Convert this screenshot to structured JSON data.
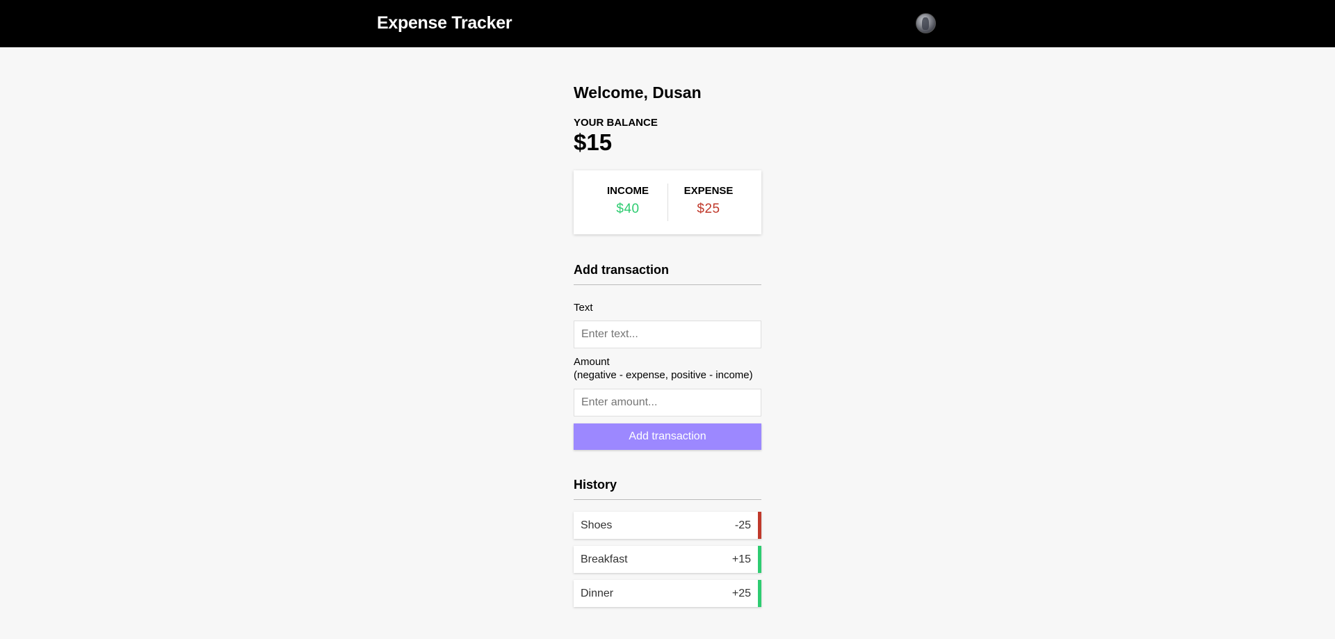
{
  "header": {
    "title": "Expense Tracker",
    "avatar_icon": "user-avatar-photo"
  },
  "welcome": "Welcome, Dusan",
  "balance": {
    "label": "YOUR BALANCE",
    "value": "$15"
  },
  "summary": {
    "income_label": "INCOME",
    "income_value": "$40",
    "expense_label": "EXPENSE",
    "expense_value": "$25"
  },
  "add_transaction": {
    "title": "Add transaction",
    "text_label": "Text",
    "text_placeholder": "Enter text...",
    "text_value": "",
    "amount_label": "Amount",
    "amount_hint": "(negative - expense, positive - income)",
    "amount_placeholder": "Enter amount...",
    "amount_value": "",
    "button_label": "Add transaction"
  },
  "history": {
    "title": "History",
    "items": [
      {
        "text": "Shoes",
        "amount": "-25",
        "type": "expense"
      },
      {
        "text": "Breakfast",
        "amount": "+15",
        "type": "income"
      },
      {
        "text": "Dinner",
        "amount": "+25",
        "type": "income"
      }
    ]
  },
  "colors": {
    "header_bg": "#000000",
    "page_bg": "#f7f7f7",
    "income": "#2ecc71",
    "expense": "#c0392b",
    "button": "#9c88ff"
  }
}
